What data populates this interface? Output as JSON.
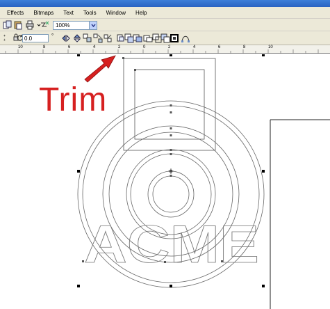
{
  "menu": {
    "items": [
      "Effects",
      "Bitmaps",
      "Text",
      "Tools",
      "Window",
      "Help"
    ]
  },
  "toolbar": {
    "zoom_value": "100%",
    "rotation_value": "0.0",
    "degree_symbol": "°"
  },
  "ruler": {
    "labels": [
      "10",
      "8",
      "6",
      "4",
      "2",
      "0",
      "2",
      "4",
      "6",
      "8",
      "10"
    ]
  },
  "annotation": {
    "label": "Trim",
    "color": "#d62020"
  },
  "artwork": {
    "logo_text": "ACME"
  },
  "colors": {
    "ui_face": "#ece9d8",
    "highlight_circle": "#d62020",
    "stroke": "#555555"
  }
}
